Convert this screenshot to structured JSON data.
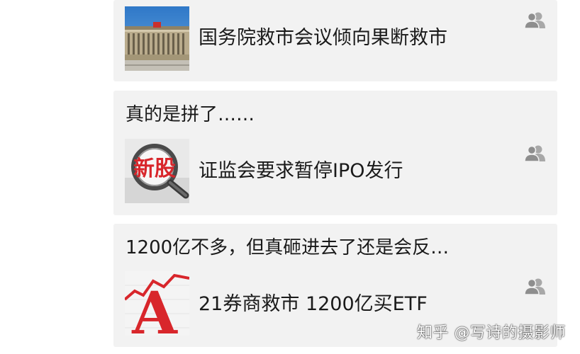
{
  "feed": {
    "cards": [
      {
        "comment": "",
        "title": "国务院救市会议倾向果断救市",
        "thumb_icon": "government-building-photo"
      },
      {
        "comment": "真的是拼了……",
        "title": "证监会要求暂停IPO发行",
        "thumb_icon": "magnifier-new-shares-photo",
        "thumb_text": "新股"
      },
      {
        "comment": "1200亿不多，但真砸进去了还是会反…",
        "title": "21券商救市 1200亿买ETF",
        "thumb_icon": "red-letter-a-chart-photo",
        "thumb_text": "A"
      }
    ],
    "action_icon": "user-group-icon"
  },
  "watermark": {
    "text": "知乎 @写诗的摄影师"
  },
  "colors": {
    "card_background": "#f2f2f2",
    "text": "#1a1a1a",
    "icon_gray": "#9a9a9a",
    "accent_red": "#d8262b"
  }
}
